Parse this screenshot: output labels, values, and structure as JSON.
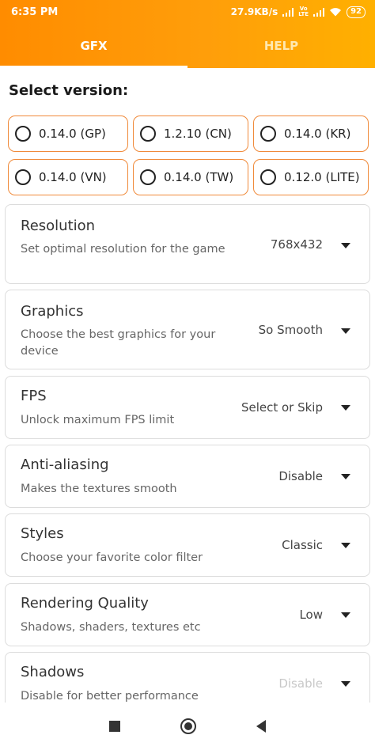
{
  "status_bar": {
    "time": "6:35 PM",
    "network_speed": "27.9KB/s",
    "volte_line1": "Vo",
    "volte_line2": "LTE",
    "battery": "92"
  },
  "tabs": [
    {
      "label": "GFX",
      "active": true
    },
    {
      "label": "HELP",
      "active": false
    }
  ],
  "section_title": "Select version:",
  "versions": [
    {
      "label": "0.14.0 (GP)"
    },
    {
      "label": "1.2.10 (CN)"
    },
    {
      "label": "0.14.0 (KR)"
    },
    {
      "label": "0.14.0 (VN)"
    },
    {
      "label": "0.14.0 (TW)"
    },
    {
      "label": "0.12.0 (LITE)"
    }
  ],
  "settings": [
    {
      "title": "Resolution",
      "desc": "Set optimal resolution for the game",
      "value": "768x432"
    },
    {
      "title": "Graphics",
      "desc": "Choose the best graphics for your device",
      "value": "So Smooth"
    },
    {
      "title": "FPS",
      "desc": "Unlock maximum FPS limit",
      "value": "Select or Skip"
    },
    {
      "title": "Anti-aliasing",
      "desc": "Makes the textures smooth",
      "value": "Disable"
    },
    {
      "title": "Styles",
      "desc": "Choose your favorite color filter",
      "value": "Classic"
    },
    {
      "title": "Rendering Quality",
      "desc": "Shadows, shaders, textures etc",
      "value": "Low"
    },
    {
      "title": "Shadows",
      "desc": "Disable for better performance",
      "value": "Disable"
    }
  ],
  "colors": {
    "accent_start": "#ff8c00",
    "accent_end": "#ffb000",
    "option_border": "#f08a3a"
  },
  "icons": {
    "nav": [
      "recents-square-icon",
      "home-circle-icon",
      "back-triangle-icon"
    ],
    "status": [
      "signal-icon",
      "wifi-icon",
      "battery-icon"
    ],
    "dropdown": "caret-down-icon"
  }
}
